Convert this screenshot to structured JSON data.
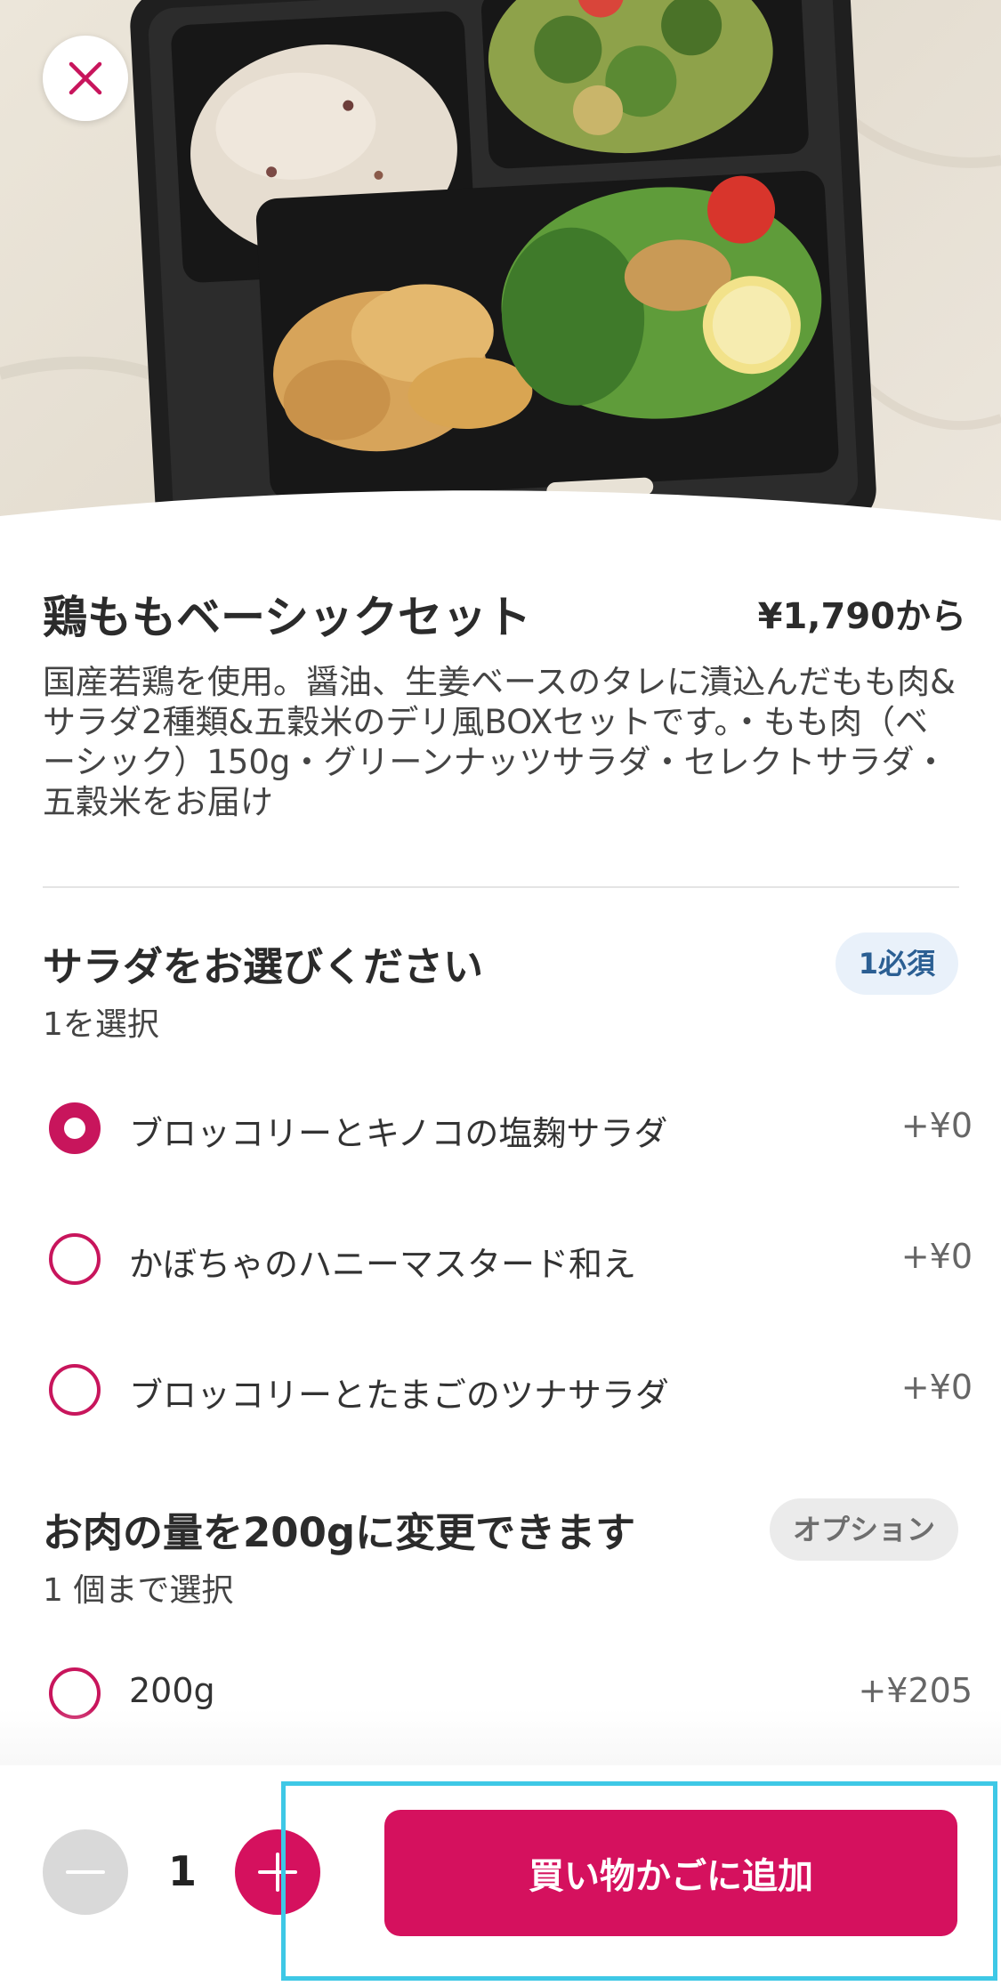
{
  "item": {
    "title": "鶏ももベーシックセット",
    "price": "¥1,790から",
    "description": "国産若鶏を使用。醤油、生姜ベースのタレに漬込んだもも肉&サラダ2種類&五穀米のデリ風BOXセットです。・もも肉（ベーシック）150g・グリーンナッツサラダ・セレクトサラダ・五穀米をお届け"
  },
  "sections": [
    {
      "title": "サラダをお選びください",
      "subtitle": "1を選択",
      "badge": "1必須",
      "options": [
        {
          "label": "ブロッコリーとキノコの塩麹サラダ",
          "price": "+¥0",
          "selected": true
        },
        {
          "label": "かぼちゃのハニーマスタード和え",
          "price": "+¥0",
          "selected": false
        },
        {
          "label": "ブロッコリーとたまごのツナサラダ",
          "price": "+¥0",
          "selected": false
        }
      ]
    },
    {
      "title": "お肉の量を200gに変更できます",
      "subtitle": "1 個まで選択",
      "badge": "オプション",
      "options": [
        {
          "label": "200g",
          "price": "+¥205",
          "selected": false
        }
      ]
    }
  ],
  "cart": {
    "quantity": "1",
    "add_label": "買い物かごに追加"
  },
  "colors": {
    "accent": "#d5115e",
    "radio": "#c8155c",
    "required_badge_bg": "#e9f1fa",
    "highlight": "#3ec8e6"
  },
  "icons": {
    "close": "close-icon",
    "minus": "minus-icon",
    "plus": "plus-icon"
  }
}
